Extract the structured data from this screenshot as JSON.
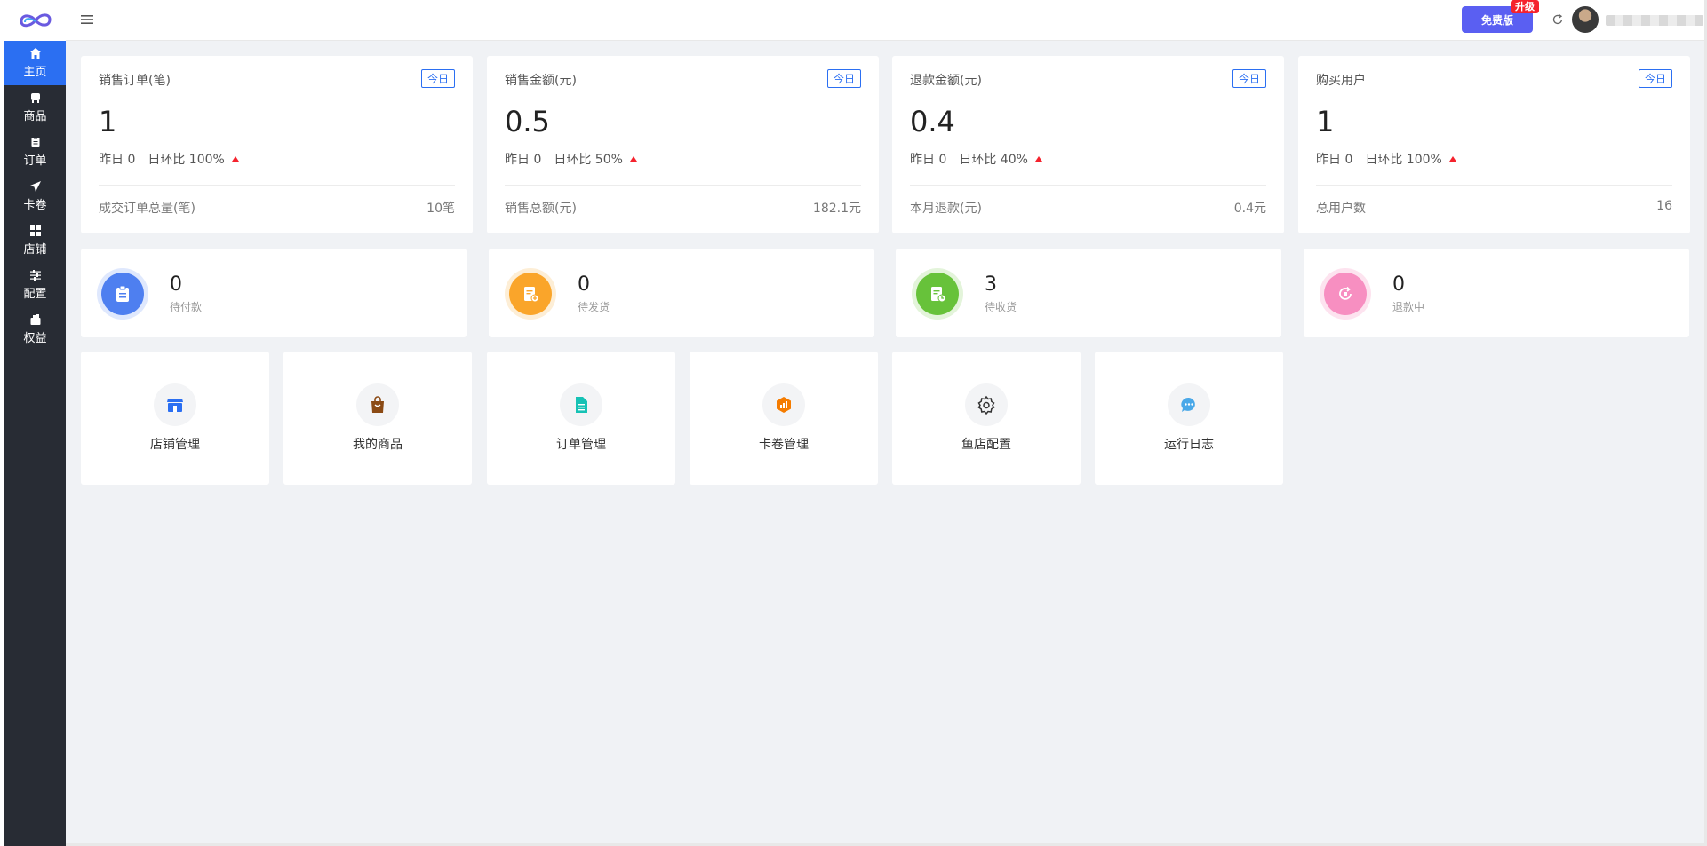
{
  "sidebar": {
    "items": [
      {
        "label": "主页",
        "icon": "home-icon",
        "active": true
      },
      {
        "label": "商品",
        "icon": "product-icon"
      },
      {
        "label": "订单",
        "icon": "order-icon"
      },
      {
        "label": "卡卷",
        "icon": "send-icon"
      },
      {
        "label": "店铺",
        "icon": "grid-icon"
      },
      {
        "label": "配置",
        "icon": "sliders-icon"
      },
      {
        "label": "权益",
        "icon": "gift-icon"
      }
    ]
  },
  "header": {
    "free_label": "免费版",
    "upgrade_label": "升级"
  },
  "stats": [
    {
      "title": "销售订单(笔)",
      "tag": "今日",
      "value": "1",
      "yesterday": "昨日 0",
      "ratio": "日环比 100%",
      "foot_label": "成交订单总量(笔)",
      "foot_value": "10笔"
    },
    {
      "title": "销售金额(元)",
      "tag": "今日",
      "value": "0.5",
      "yesterday": "昨日 0",
      "ratio": "日环比 50%",
      "foot_label": "销售总额(元)",
      "foot_value": "182.1元"
    },
    {
      "title": "退款金额(元)",
      "tag": "今日",
      "value": "0.4",
      "yesterday": "昨日 0",
      "ratio": "日环比 40%",
      "foot_label": "本月退款(元)",
      "foot_value": "0.4元"
    },
    {
      "title": "购买用户",
      "tag": "今日",
      "value": "1",
      "yesterday": "昨日 0",
      "ratio": "日环比 100%",
      "foot_label": "总用户数",
      "foot_value": "16"
    }
  ],
  "order_status": [
    {
      "count": "0",
      "label": "待付款",
      "color": "#4e7ff0",
      "ring": "#dfe8fd",
      "icon": "clipboard-icon"
    },
    {
      "count": "0",
      "label": "待发货",
      "color": "#faa52a",
      "ring": "#fdeed6",
      "icon": "ship-doc-icon"
    },
    {
      "count": "3",
      "label": "待收货",
      "color": "#67c23a",
      "ring": "#e3f4da",
      "icon": "receive-doc-icon"
    },
    {
      "count": "0",
      "label": "退款中",
      "color": "#f78fc1",
      "ring": "#fde3ef",
      "icon": "refund-icon"
    }
  ],
  "quick_links": [
    {
      "label": "店铺管理",
      "icon": "store-icon",
      "color": "#2b6ff2"
    },
    {
      "label": "我的商品",
      "icon": "bag-icon",
      "color": "#8b4a14"
    },
    {
      "label": "订单管理",
      "icon": "document-icon",
      "color": "#16c2b5"
    },
    {
      "label": "卡卷管理",
      "icon": "hex-chart-icon",
      "color": "#f57c00"
    },
    {
      "label": "鱼店配置",
      "icon": "gear-icon",
      "color": "#333333"
    },
    {
      "label": "运行日志",
      "icon": "chat-icon",
      "color": "#4aa8e8"
    }
  ]
}
